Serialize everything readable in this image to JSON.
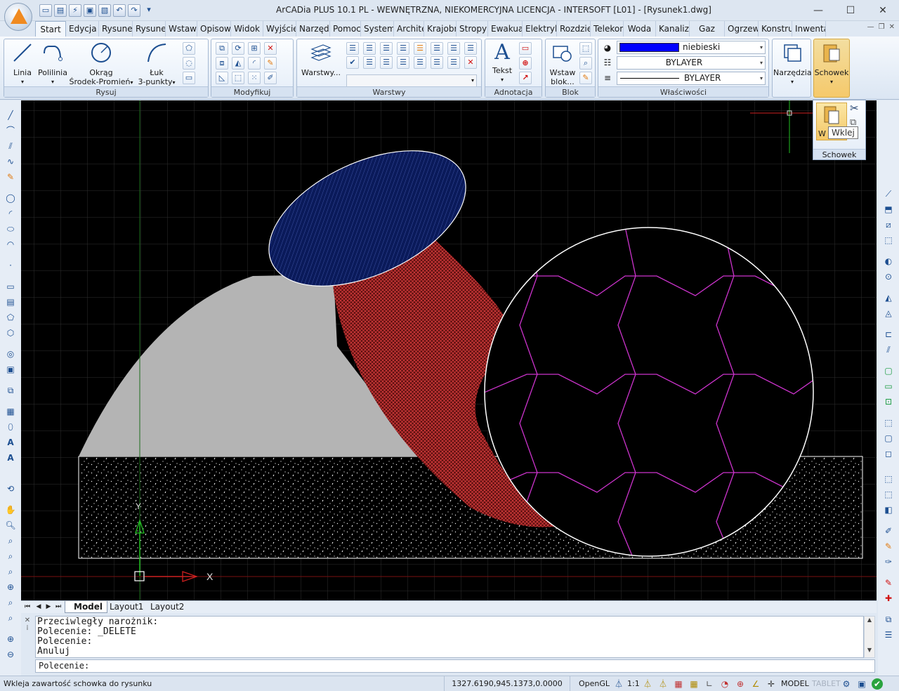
{
  "window": {
    "title": "ArCADia PLUS 10.1 PL - WEWNĘTRZNA, NIEKOMERCYJNA LICENCJA - INTERSOFT [L01] - [Rysunek1.dwg]",
    "minimize": "—",
    "maximize": "☐",
    "close": "✕"
  },
  "ribbon_tabs": [
    "Start",
    "Edycja",
    "Rysuneł",
    "Rysuneł",
    "Wstaw",
    "Opisow",
    "Widok",
    "Wyjście",
    "Narzędz",
    "Pomoc",
    "System",
    "Architeł",
    "Krajobra",
    "Stropy",
    "Ewakua",
    "Elektryk",
    "Rozdzie",
    "Telekom",
    "Woda",
    "Kanalizc",
    "Gaz",
    "Ogrzew",
    "Konstru",
    "Inwenta"
  ],
  "panels": {
    "rysuj": {
      "title": "Rysuj",
      "linia": "Linia",
      "polilinia": "Polilinia",
      "okrag_1": "Okrąg",
      "okrag_2": "Środek-Promień",
      "luk_1": "Łuk",
      "luk_2": "3-punkty"
    },
    "modyfikuj": {
      "title": "Modyfikuj"
    },
    "warstwy": {
      "title": "Warstwy",
      "warstwy_btn": "Warstwy..."
    },
    "adnotacja": {
      "title": "Adnotacja",
      "tekst": "Tekst"
    },
    "blok": {
      "title": "Blok",
      "wstaw_1": "Wstaw",
      "wstaw_2": "blok..."
    },
    "wlasciwosci": {
      "title": "Właściwości",
      "color": "niebieski",
      "color_hex": "#0000ff",
      "linetype": "BYLAYER",
      "lineweight": "BYLAYER"
    },
    "narzedzia": {
      "label": "Narzędzia"
    },
    "schowek": {
      "label": "Schowek"
    }
  },
  "flyout": {
    "title": "Schowek",
    "tooltip": "Wklej",
    "hidden_label": "W"
  },
  "canvas": {
    "axis_y": "Y",
    "axis_x": "X",
    "colors": {
      "ellipse_fill": "#0a1a5a",
      "red_hatch": "#9a1f1f",
      "grey_fill": "#b4b4b4",
      "magenta": "#cc33cc"
    }
  },
  "layout_tabs": [
    "Model",
    "Layout1",
    "Layout2"
  ],
  "command": {
    "history": [
      "Przeciwległy narożnik:",
      "Polecenie: _DELETE",
      "Polecenie:",
      "Anuluj"
    ],
    "prompt": "Polecenie:"
  },
  "status": {
    "message": "Wkleja zawartość schowka do rysunku",
    "coords": "1327.6190,945.1373,0.0000",
    "renderer": "OpenGL",
    "scale": "1:1",
    "model": "MODEL",
    "tablet": "TABLET"
  }
}
